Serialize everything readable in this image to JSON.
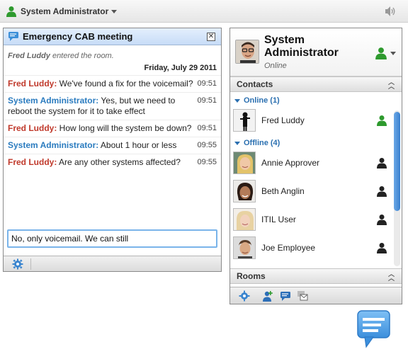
{
  "topbar": {
    "user_name": "System Administrator",
    "user_icon": "person-online-icon",
    "volume_icon": "speaker-icon"
  },
  "chat": {
    "title": "Emergency CAB meeting",
    "system_message": {
      "user": "Fred Luddy",
      "text": " entered the room."
    },
    "date": "Friday, July 29 2011",
    "messages": [
      {
        "sender": "Fred Luddy:",
        "text": " We've found a fix for the voicemail?",
        "time": "09:51",
        "color": "#c0392b"
      },
      {
        "sender": "System Administrator:",
        "text": " Yes, but we need to reboot the system for it to take effect",
        "time": "09:51",
        "color": "#2a7bbf"
      },
      {
        "sender": "Fred Luddy:",
        "text": " How long will the system be down?",
        "time": "09:51",
        "color": "#c0392b"
      },
      {
        "sender": "System Administrator:",
        "text": " About 1 hour or less",
        "time": "09:55",
        "color": "#2a7bbf"
      },
      {
        "sender": "Fred Luddy:",
        "text": " Are any other systems affected?",
        "time": "09:55",
        "color": "#c0392b"
      }
    ],
    "input_value": "No, only voicemail. We can still",
    "footer_icon": "gear-icon"
  },
  "buddy_list": {
    "self_name": "System Administrator",
    "self_status": "Online",
    "contacts_header": "Contacts",
    "online_group": "Online (1)",
    "offline_group": "Offline (4)",
    "online_contacts": [
      {
        "name": "Fred Luddy",
        "status": "online"
      }
    ],
    "offline_contacts": [
      {
        "name": "Annie Approver",
        "status": "offline"
      },
      {
        "name": "Beth Anglin",
        "status": "offline"
      },
      {
        "name": "ITIL User",
        "status": "offline"
      },
      {
        "name": "Joe Employee",
        "status": "offline"
      }
    ],
    "rooms_header": "Rooms",
    "footer_icons": [
      "gear-icon",
      "add-contact-icon",
      "create-room-icon",
      "email-icon"
    ]
  },
  "colors": {
    "online_green": "#2e9a2e",
    "offline_black": "#222222",
    "accent_blue": "#2a7bbf",
    "sender_red": "#c0392b"
  }
}
